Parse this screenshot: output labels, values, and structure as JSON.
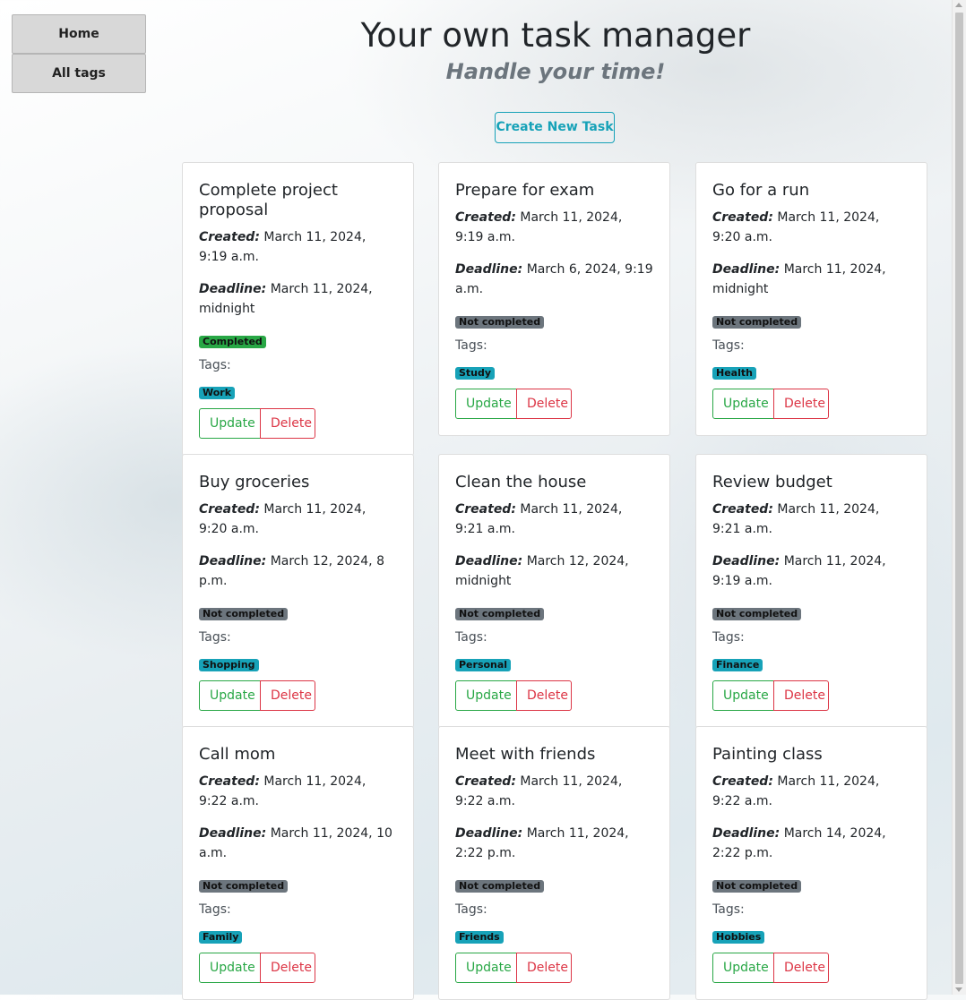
{
  "nav": {
    "home": "Home",
    "all_tags": "All tags"
  },
  "header": {
    "title": "Your own task manager",
    "subtitle": "Handle your time!",
    "create_button": "Create New Task"
  },
  "labels": {
    "created": "Created:",
    "deadline": "Deadline:",
    "tags": "Tags:",
    "update": "Update",
    "delete": "Delete"
  },
  "tasks": [
    {
      "title": "Complete project proposal",
      "created": "March 11, 2024, 9:19 a.m.",
      "deadline": "March 11, 2024, midnight",
      "status": "Completed",
      "tag": "Work"
    },
    {
      "title": "Prepare for exam",
      "created": "March 11, 2024, 9:19 a.m.",
      "deadline": "March 6, 2024, 9:19 a.m.",
      "status": "Not completed",
      "tag": "Study"
    },
    {
      "title": "Go for a run",
      "created": "March 11, 2024, 9:20 a.m.",
      "deadline": "March 11, 2024, midnight",
      "status": "Not completed",
      "tag": "Health"
    },
    {
      "title": "Buy groceries",
      "created": "March 11, 2024, 9:20 a.m.",
      "deadline": "March 12, 2024, 8 p.m.",
      "status": "Not completed",
      "tag": "Shopping"
    },
    {
      "title": "Clean the house",
      "created": "March 11, 2024, 9:21 a.m.",
      "deadline": "March 12, 2024, midnight",
      "status": "Not completed",
      "tag": "Personal"
    },
    {
      "title": "Review budget",
      "created": "March 11, 2024, 9:21 a.m.",
      "deadline": "March 11, 2024, 9:19 a.m.",
      "status": "Not completed",
      "tag": "Finance"
    },
    {
      "title": "Call mom",
      "created": "March 11, 2024, 9:22 a.m.",
      "deadline": "March 11, 2024, 10 a.m.",
      "status": "Not completed",
      "tag": "Family"
    },
    {
      "title": "Meet with friends",
      "created": "March 11, 2024, 9:22 a.m.",
      "deadline": "March 11, 2024, 2:22 p.m.",
      "status": "Not completed",
      "tag": "Friends"
    },
    {
      "title": "Painting class",
      "created": "March 11, 2024, 9:22 a.m.",
      "deadline": "March 14, 2024, 2:22 p.m.",
      "status": "Not completed",
      "tag": "Hobbies"
    }
  ],
  "colors": {
    "completed": "#28a745",
    "not_completed": "#6c757d",
    "tag": "#17a2b8",
    "update": "#28a745",
    "delete": "#dc3545",
    "create": "#17a2b8"
  }
}
